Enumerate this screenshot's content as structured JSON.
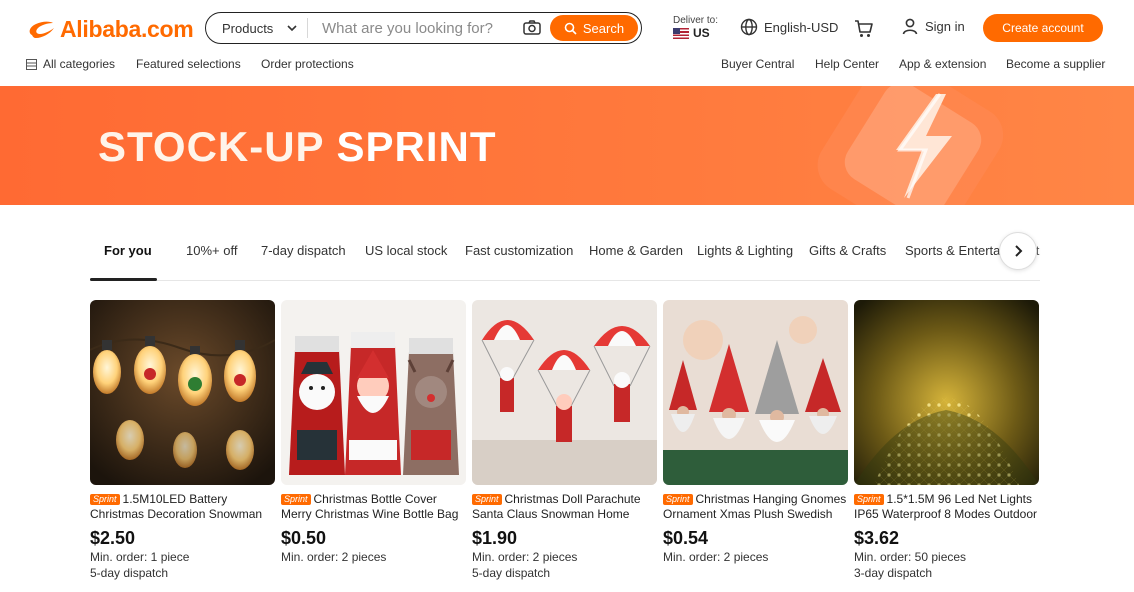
{
  "header": {
    "logo_text": "Alibaba.com",
    "search": {
      "type_label": "Products",
      "placeholder": "What are you looking for?",
      "button_label": "Search"
    },
    "deliver": {
      "label": "Deliver to:",
      "country": "US"
    },
    "language_currency": "English-USD",
    "sign_in": "Sign in",
    "create_account": "Create account",
    "accent": "#ff6a00"
  },
  "subnav": {
    "all_categories": "All categories",
    "featured": "Featured selections",
    "order_protections": "Order protections",
    "buyer_central": "Buyer Central",
    "help_center": "Help Center",
    "app_extension": "App & extension",
    "become_supplier": "Become a supplier"
  },
  "banner": {
    "title_part1": "STOCK-UP",
    "title_part2": "SPRINT",
    "background": "#ff7335"
  },
  "tabs": [
    {
      "label": "For you",
      "active": true
    },
    {
      "label": "10%+ off"
    },
    {
      "label": "7-day dispatch"
    },
    {
      "label": "US local stock"
    },
    {
      "label": "Fast customization"
    },
    {
      "label": "Home & Garden"
    },
    {
      "label": "Lights & Lighting"
    },
    {
      "label": "Gifts & Crafts"
    },
    {
      "label": "Sports & Entertainment"
    }
  ],
  "products": [
    {
      "badge": "Sprint",
      "title": "1.5M10LED Battery Christmas Decoration Snowman",
      "price": "$2.50",
      "moq": "Min. order: 1 piece",
      "shipping": "5-day dispatch"
    },
    {
      "badge": "Sprint",
      "title": "Christmas Bottle Cover Merry Christmas Wine Bottle Bag",
      "price": "$0.50",
      "moq": "Min. order: 2 pieces",
      "shipping": ""
    },
    {
      "badge": "Sprint",
      "title": "Christmas Doll Parachute Santa Claus Snowman Home",
      "price": "$1.90",
      "moq": "Min. order: 2 pieces",
      "shipping": "5-day dispatch"
    },
    {
      "badge": "Sprint",
      "title": "Christmas Hanging Gnomes Ornament Xmas Plush Swedish",
      "price": "$0.54",
      "moq": "Min. order: 2 pieces",
      "shipping": ""
    },
    {
      "badge": "Sprint",
      "title": "1.5*1.5M 96 Led Net Lights IP65 Waterproof 8 Modes Outdoor",
      "price": "$3.62",
      "moq": "Min. order: 50 pieces",
      "shipping": "3-day dispatch"
    }
  ]
}
